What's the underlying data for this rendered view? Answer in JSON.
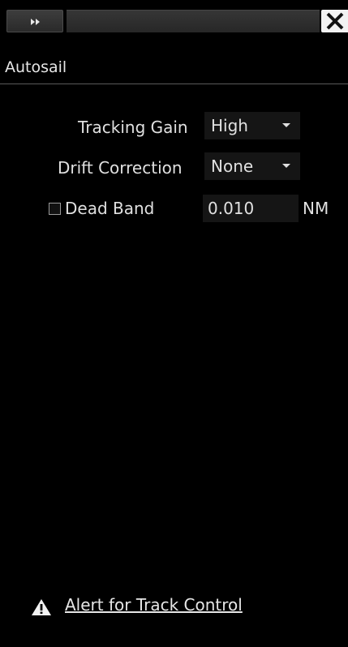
{
  "toolbar": {
    "expand_icon": "double-chevron-right-icon",
    "close_icon": "close-icon"
  },
  "panel": {
    "title": "Autosail"
  },
  "settings": {
    "tracking_gain_label": "Tracking Gain",
    "tracking_gain_value": "High",
    "drift_correction_label": "Drift Correction",
    "drift_correction_value": "None",
    "dead_band_label": "Dead Band",
    "dead_band_checked": false,
    "dead_band_value": "0.010",
    "dead_band_unit": "NM"
  },
  "alert": {
    "icon": "warning-icon",
    "link_label": "Alert for Track Control"
  },
  "colors": {
    "background": "#000000",
    "text": "#e6e6e6",
    "field_bg": "#151515",
    "close_bg": "#f2f2f2"
  }
}
